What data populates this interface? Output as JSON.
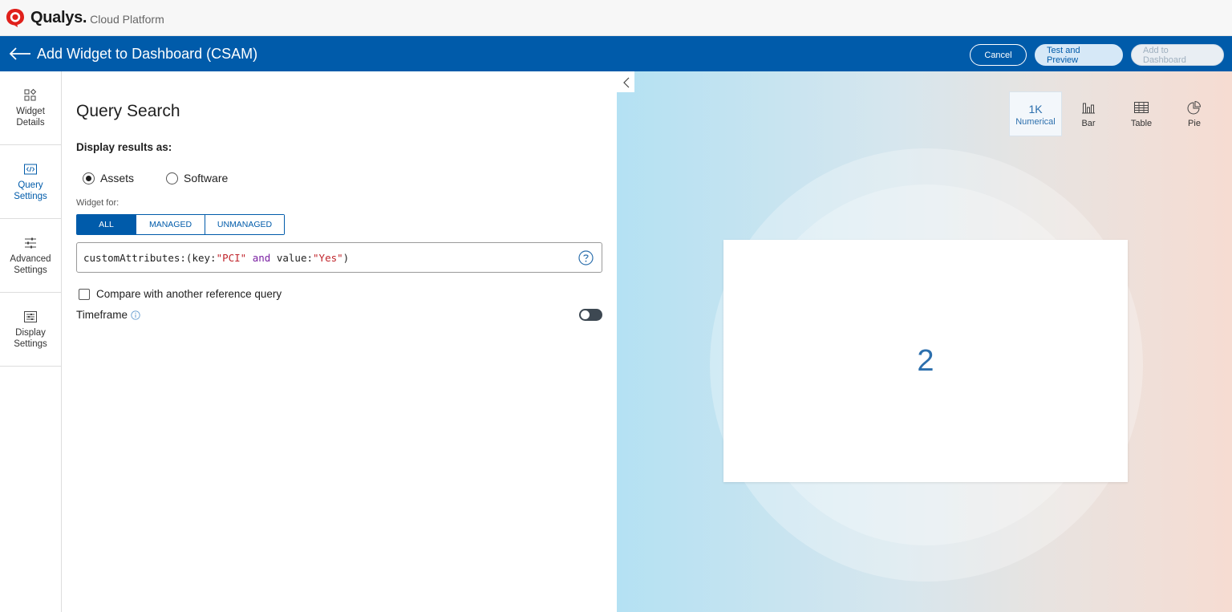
{
  "brand": {
    "name": "Qualys.",
    "sub": "Cloud Platform",
    "color": "#e0201b"
  },
  "header": {
    "title": "Add Widget to Dashboard (CSAM)",
    "cancel_label": "Cancel",
    "test_label": "Test and Preview",
    "add_label": "Add to Dashboard",
    "bg_color": "#005baa"
  },
  "rail": {
    "items": [
      {
        "line1": "Widget",
        "line2": "Details",
        "icon": "widget-details-icon"
      },
      {
        "line1": "Query",
        "line2": "Settings",
        "icon": "code-icon",
        "active": true
      },
      {
        "line1": "Advanced",
        "line2": "Settings",
        "icon": "sliders-icon"
      },
      {
        "line1": "Display",
        "line2": "Settings",
        "icon": "display-settings-icon"
      }
    ]
  },
  "form": {
    "title": "Query Search",
    "display_label": "Display results as:",
    "radio_assets": "Assets",
    "radio_software": "Software",
    "selected_radio": "Assets",
    "widget_for_label": "Widget for:",
    "segments": [
      "ALL",
      "MANAGED",
      "UNMANAGED"
    ],
    "selected_segment": "ALL",
    "query": {
      "p1": "customAttributes:(key:",
      "s1": "\"PCI\"",
      "p2": " ",
      "kw": "and",
      "p3": " value:",
      "s2": "\"Yes\"",
      "p4": ")"
    },
    "compare_label": "Compare with another reference query",
    "compare_checked": false,
    "timeframe_label": "Timeframe",
    "timeframe_on": false
  },
  "preview": {
    "viz_types": [
      {
        "glyph": "1K",
        "label": "Numerical",
        "icon": "numerical-icon",
        "active": true
      },
      {
        "label": "Bar",
        "icon": "bar-chart-icon"
      },
      {
        "label": "Table",
        "icon": "table-icon"
      },
      {
        "label": "Pie",
        "icon": "pie-chart-icon"
      }
    ],
    "result_value": "2"
  }
}
